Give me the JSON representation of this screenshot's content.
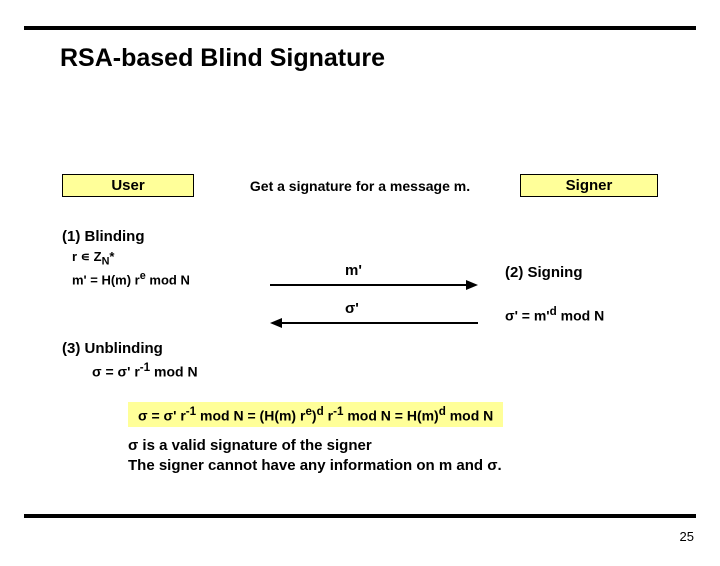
{
  "title": "RSA-based Blind Signature",
  "user_label": "User",
  "signer_label": "Signer",
  "center_label": "Get a signature for a message m.",
  "step1_title": "(1) Blinding",
  "step1_line1": "r ∊ Z",
  "step1_line1_sub": "N",
  "step1_line1_post": "*",
  "step1_line2_pre": "m' = H(m) r",
  "step1_line2_sup": "e",
  "step1_line2_post": " mod N",
  "arrow_right_label": "m'",
  "arrow_left_label": "σ'",
  "step2_title": "(2) Signing",
  "step2_formula_pre": "σ' = m'",
  "step2_formula_sup": "d",
  "step2_formula_post": " mod N",
  "step3_title": "(3) Unblinding",
  "step3_formula_pre": "σ = σ' r",
  "step3_formula_sup": "-1",
  "step3_formula_post": " mod N",
  "deriv_1": "σ = σ' r",
  "deriv_s1": "-1",
  "deriv_2": " mod N = (H(m) r",
  "deriv_s2": "e",
  "deriv_3": ")",
  "deriv_s3": "d",
  "deriv_4": " r",
  "deriv_s4": "-1",
  "deriv_5": " mod N = H(m)",
  "deriv_s5": "d",
  "deriv_6": " mod N",
  "conclusion_l1": "σ is a valid signature of the signer",
  "conclusion_l2": "The signer cannot have any information on m and σ.",
  "page_number": "25"
}
